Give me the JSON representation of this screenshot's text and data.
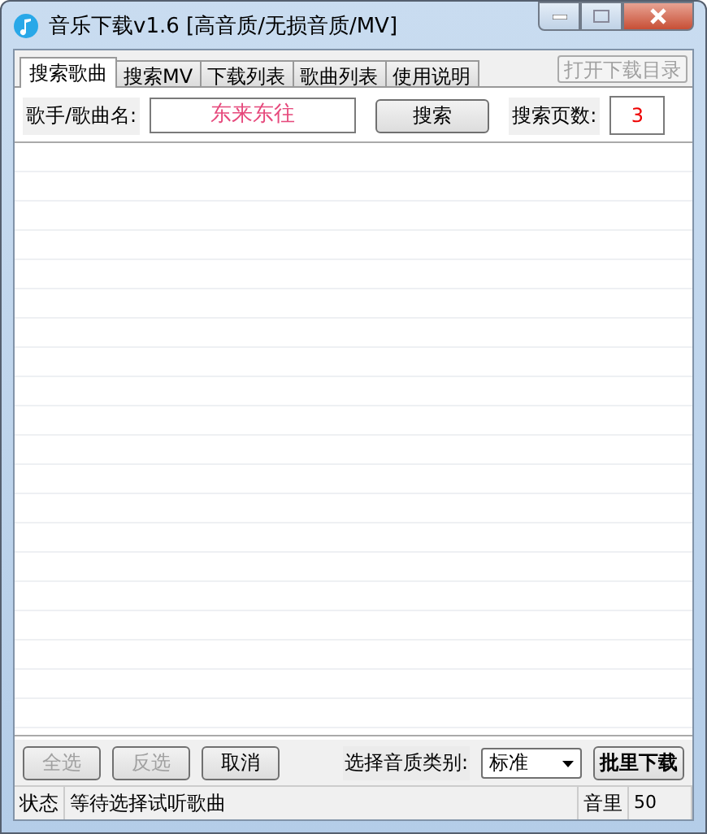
{
  "window": {
    "title": "音乐下载v1.6 [高音质/无损音质/MV]"
  },
  "tabs": [
    {
      "label": "搜索歌曲",
      "selected": true
    },
    {
      "label": "搜索MV",
      "selected": false
    },
    {
      "label": "下载列表",
      "selected": false
    },
    {
      "label": "歌曲列表",
      "selected": false
    },
    {
      "label": "使用说明",
      "selected": false
    }
  ],
  "open_folder_button": {
    "label": "打开下载目录",
    "disabled": true
  },
  "search": {
    "label": "歌手/歌曲名:",
    "value": "东来东往",
    "button": "搜索",
    "pages_label": "搜索页数:",
    "pages_value": "3"
  },
  "actions": [
    {
      "label": "全选",
      "disabled": true
    },
    {
      "label": "反选",
      "disabled": true
    },
    {
      "label": "取消",
      "disabled": false
    }
  ],
  "quality": {
    "label": "选择音质类别:",
    "value": "标准"
  },
  "batch_button": "批里下载",
  "status_bar": {
    "label": "状态",
    "message": "等待选择试听歌曲",
    "volume_label": "音里",
    "volume": "50"
  }
}
